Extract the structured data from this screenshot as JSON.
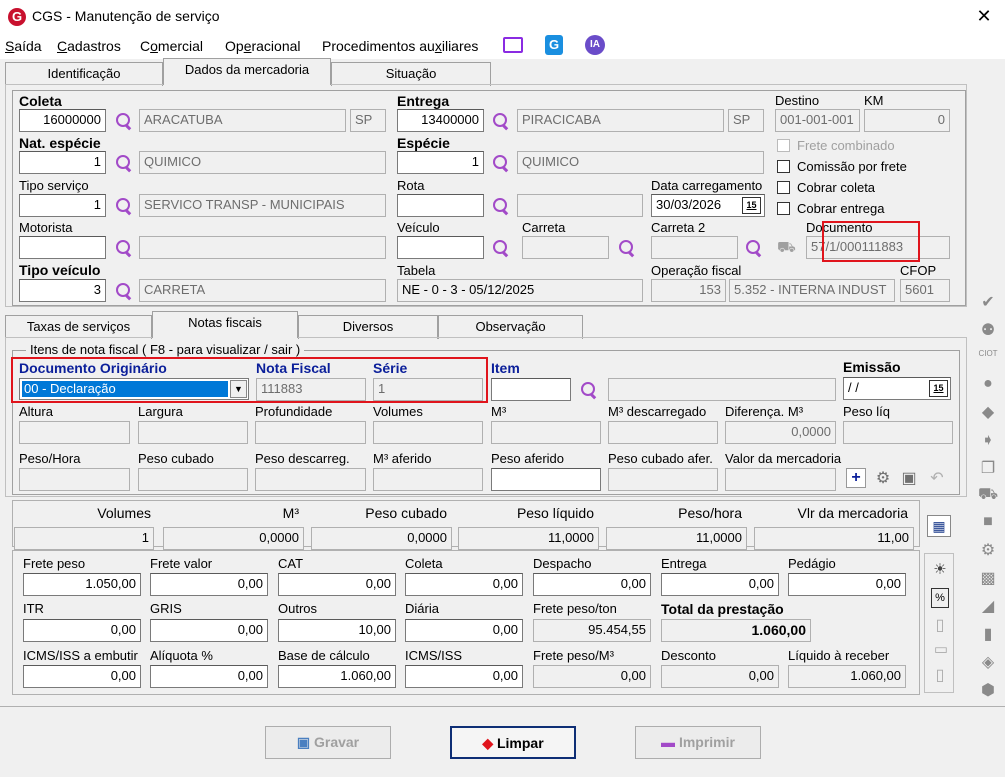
{
  "window": {
    "title": "CGS - Manutenção de serviço",
    "close": "✕"
  },
  "menu": [
    {
      "label": "Saída",
      "u": "S",
      "rest": "aída"
    },
    {
      "label": "Cadastros",
      "u": "C",
      "rest": "adastros"
    },
    {
      "label": "Comercial",
      "pre": "C",
      "u": "o",
      "rest": "mercial"
    },
    {
      "label": "Operacional",
      "pre": "Op",
      "u": "e",
      "rest": "racional"
    },
    {
      "label": "Procedimentos auxiliares",
      "pre": "Procedimentos au",
      "u": "x",
      "rest": "iliares"
    }
  ],
  "menu_icons": {
    "monitor": "monitor-icon",
    "g": "G",
    "ia": "IA"
  },
  "tabs_top": [
    "Identificação",
    "Dados da mercadoria",
    "Situação"
  ],
  "form": {
    "coleta": {
      "label": "Coleta",
      "code": "16000000",
      "city": "ARACATUBA",
      "uf": "SP"
    },
    "entrega": {
      "label": "Entrega",
      "code": "13400000",
      "city": "PIRACICABA",
      "uf": "SP"
    },
    "destino": {
      "label": "Destino",
      "value": "001-001-001"
    },
    "km": {
      "label": "KM",
      "value": "0"
    },
    "nat_especie": {
      "label": "Nat. espécie",
      "code": "1",
      "desc": "QUIMICO"
    },
    "especie": {
      "label": "Espécie",
      "code": "1",
      "desc": "QUIMICO"
    },
    "tipo_servico": {
      "label": "Tipo serviço",
      "code": "1",
      "desc": "SERVICO TRANSP - MUNICIPAIS"
    },
    "rota": {
      "label": "Rota",
      "code": "",
      "desc": ""
    },
    "data_carregamento": {
      "label": "Data carregamento",
      "value": "30/03/2026"
    },
    "motorista": {
      "label": "Motorista",
      "code": "",
      "desc": ""
    },
    "veiculo": {
      "label": "Veículo",
      "value": ""
    },
    "carreta": {
      "label": "Carreta",
      "value": ""
    },
    "carreta2": {
      "label": "Carreta 2",
      "value": ""
    },
    "documento": {
      "label": "Documento",
      "value": "57/1/000111883"
    },
    "tipo_veiculo": {
      "label": "Tipo veículo",
      "code": "3",
      "desc": "CARRETA"
    },
    "tabela": {
      "label": "Tabela",
      "value": "NE - 0 - 3 - 05/12/2025"
    },
    "operacao_fiscal": {
      "label": "Operação fiscal",
      "code": "153",
      "desc": "5.352 - INTERNA INDUST"
    },
    "cfop": {
      "label": "CFOP",
      "value": "5601"
    },
    "checks": {
      "frete_combinado": "Frete combinado",
      "comissao": "Comissão por frete",
      "cobrar_coleta": "Cobrar coleta",
      "cobrar_entrega": "Cobrar entrega"
    }
  },
  "tabs_mid": [
    "Taxas de serviços",
    "Notas fiscais",
    "Diversos",
    "Observação"
  ],
  "nf": {
    "group": "Itens de nota fiscal ( F8 - para visualizar / sair )",
    "doc_orig": {
      "label": "Documento Originário",
      "value": "00 - Declaração"
    },
    "nota_fiscal": {
      "label": "Nota Fiscal",
      "value": "111883"
    },
    "serie": {
      "label": "Série",
      "value": "1"
    },
    "item": {
      "label": "Item",
      "value": ""
    },
    "emissao": {
      "label": "Emissão",
      "value": " / /"
    },
    "row2": [
      "Altura",
      "Largura",
      "Profundidade",
      "Volumes",
      "M³",
      "M³ descarregado",
      "Diferença. M³",
      "Peso líq"
    ],
    "diferenca": "0,0000",
    "row3": [
      "Peso/Hora",
      "Peso cubado",
      "Peso descarreg.",
      "M³ aferido",
      "Peso aferido",
      "Peso cubado afer.",
      "Valor da mercadoria"
    ]
  },
  "summary": {
    "headers": [
      "Volumes",
      "M³",
      "Peso cubado",
      "Peso líquido",
      "Peso/hora",
      "Vlr da mercadoria"
    ],
    "values": [
      "1",
      "0,0000",
      "0,0000",
      "11,0000",
      "11,0000",
      "11,00"
    ]
  },
  "totals": {
    "r1": [
      {
        "l": "Frete peso",
        "v": "1.050,00"
      },
      {
        "l": "Frete valor",
        "v": "0,00"
      },
      {
        "l": "CAT",
        "v": "0,00"
      },
      {
        "l": "Coleta",
        "v": "0,00"
      },
      {
        "l": "Despacho",
        "v": "0,00"
      },
      {
        "l": "Entrega",
        "v": "0,00"
      },
      {
        "l": "Pedágio",
        "v": "0,00"
      }
    ],
    "r2": [
      {
        "l": "ITR",
        "v": "0,00"
      },
      {
        "l": "GRIS",
        "v": "0,00"
      },
      {
        "l": "Outros",
        "v": "10,00"
      },
      {
        "l": "Diária",
        "v": "0,00"
      },
      {
        "l": "Frete peso/ton",
        "v": "95.454,55"
      },
      {
        "l": "Total da prestação",
        "v": "1.060,00"
      }
    ],
    "r3": [
      {
        "l": "ICMS/ISS a embutir",
        "v": "0,00"
      },
      {
        "l": "Alíquota %",
        "v": "0,00"
      },
      {
        "l": "Base de cálculo",
        "v": "1.060,00"
      },
      {
        "l": "ICMS/ISS",
        "v": "0,00"
      },
      {
        "l": "Frete peso/M³",
        "v": "0,00"
      },
      {
        "l": "Desconto",
        "v": "0,00"
      },
      {
        "l": "Líquido à receber",
        "v": "1.060,00"
      }
    ]
  },
  "buttons": {
    "gravar": "Gravar",
    "limpar": "Limpar",
    "imprimir": "Imprimir"
  },
  "colors": {
    "accent": "#0078d7",
    "highlight": "#e0141c",
    "label_blue": "#0b1f9a",
    "icon_purple": "#a24ac8"
  }
}
